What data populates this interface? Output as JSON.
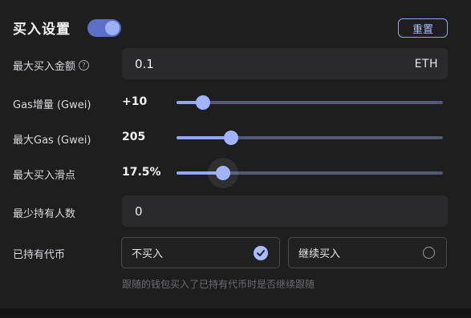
{
  "header": {
    "title": "买入设置",
    "toggle_on": true,
    "reset_label": "重置"
  },
  "max_buy": {
    "label": "最大买入金额",
    "help_icon": "question-circle-icon",
    "value": "0.1",
    "unit": "ETH"
  },
  "gas_increase": {
    "label": "Gas增量 (Gwei)",
    "value_text": "+10",
    "fraction": 0.1
  },
  "max_gas": {
    "label": "最大Gas (Gwei)",
    "value_text": "205",
    "fraction": 0.205
  },
  "max_slippage": {
    "label": "最大买入滑点",
    "value_text": "17.5%",
    "fraction": 0.175
  },
  "min_holders": {
    "label": "最少持有人数",
    "value": "0"
  },
  "held_token": {
    "label": "已持有代币",
    "options": [
      {
        "label": "不买入",
        "selected": true,
        "icon": "check-circle-icon"
      },
      {
        "label": "继续买入",
        "selected": false,
        "icon": "radio-empty-icon"
      }
    ],
    "hint": "跟随的钱包买入了已持有代币时是否继续跟随"
  },
  "colors": {
    "accent": "#9fb3ff",
    "track": "#535874",
    "background": "#1e1e1f",
    "field": "#2a2a2c"
  }
}
